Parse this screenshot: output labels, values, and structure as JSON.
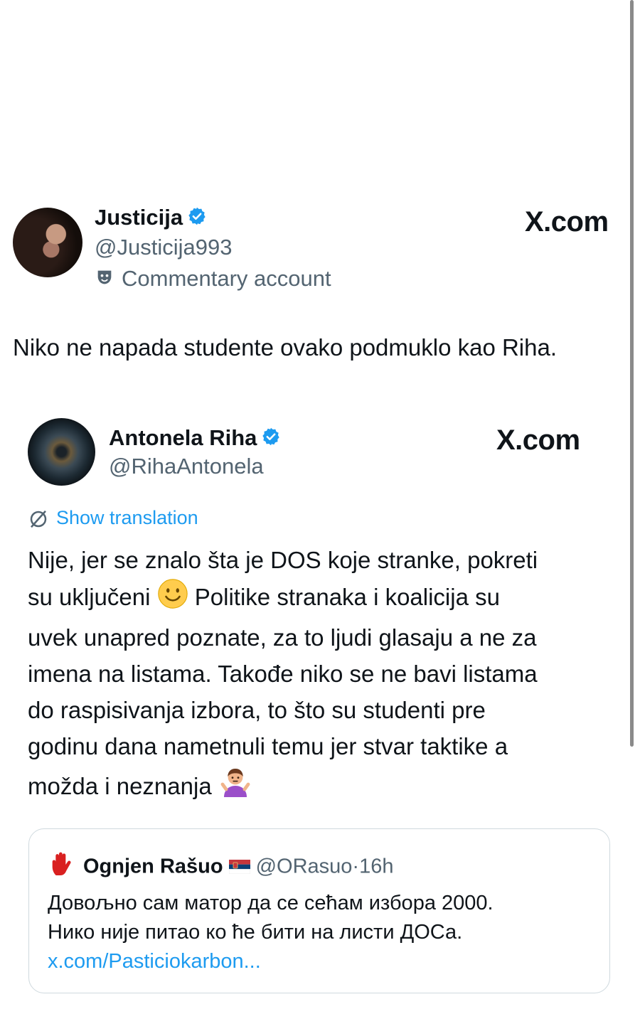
{
  "tweet1": {
    "display_name": "Justicija",
    "handle": "@Justicija993",
    "account_label": "Commentary account",
    "watermark": "X.com",
    "text": "Niko ne napada studente ovako podmuklo kao Riha."
  },
  "tweet2": {
    "display_name": "Antonela Riha",
    "handle": "@RihaAntonela",
    "watermark": "X.com",
    "translate_label": "Show translation",
    "body_lines": [
      "Nije, jer se znalo šta je DOS koje stranke, pokreti",
      "su uključeni",
      "Politike stranaka i koalicija su",
      "uvek unapred poznate, za to ljudi glasaju a ne za",
      "imena na listama. Takođe niko se ne bavi listama",
      "do raspisivanja izbora, to što su studenti pre",
      "godinu dana nametnuli temu jer stvar taktike a",
      "možda i neznanja"
    ]
  },
  "quoted": {
    "display_name": "Ognjen Rašuo",
    "handle": "@ORasuo",
    "separator": "·",
    "time": "16h",
    "body_lines": [
      "Довољно сам матор да се сећам избора 2000.",
      "Нико није питао ко ће бити на листи ДОСа."
    ],
    "link": "x.com/Pasticiokarbon..."
  },
  "colors": {
    "link": "#1d9bf0",
    "secondary_text": "#536471",
    "verified": "#1d9bf0"
  },
  "icons": [
    "verified-badge-icon",
    "commentary-mask-icon",
    "translate-icon",
    "slight-smile-emoji",
    "shrug-emoji",
    "red-hand-icon",
    "serbian-flag-icon"
  ]
}
